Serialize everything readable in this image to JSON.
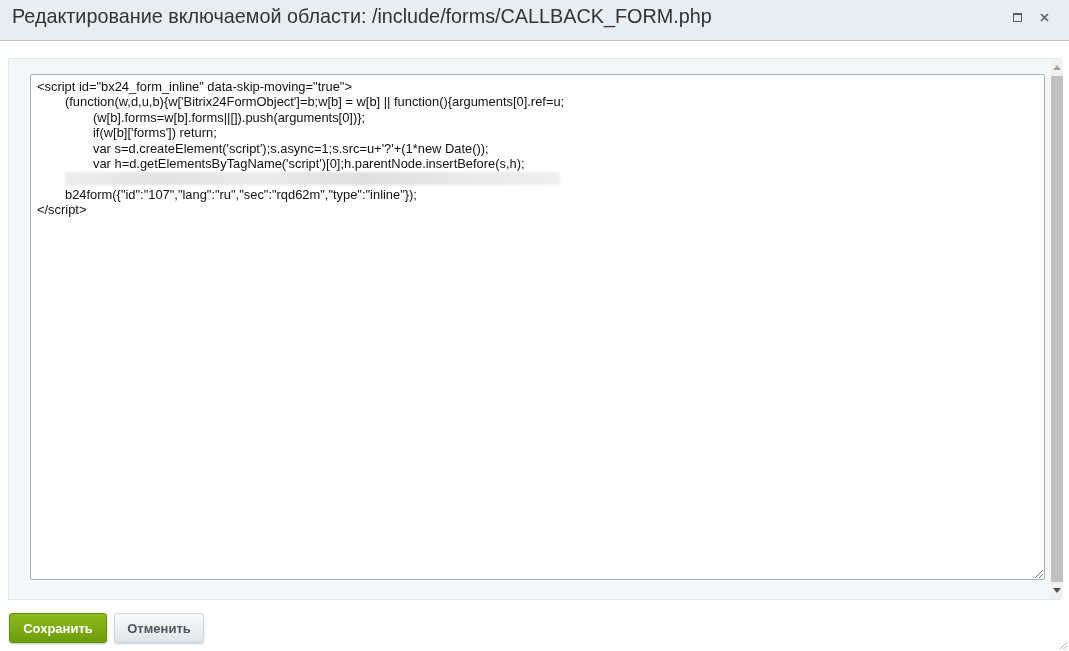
{
  "window": {
    "title": "Редактирование включаемой области: /include/forms/CALLBACK_FORM.php"
  },
  "editor": {
    "lines": [
      {
        "kind": "text",
        "text": "<script id=\"bx24_form_inline\" data-skip-moving=\"true\">",
        "children": [
          {
            "kind": "text",
            "text": "(function(w,d,u,b){w['Bitrix24FormObject']=b;w[b] = w[b] || function(){arguments[0].ref=u;",
            "children": [
              {
                "kind": "text",
                "text": "(w[b].forms=w[b].forms||[]).push(arguments[0])};"
              },
              {
                "kind": "text",
                "text": "if(w[b]['forms']) return;"
              },
              {
                "kind": "text",
                "text": "var s=d.createElement('script');s.async=1;s.src=u+'?'+(1*new Date());"
              },
              {
                "kind": "text",
                "text": "var h=d.getElementsByTagName('script')[0];h.parentNode.insertBefore(s,h);"
              }
            ]
          },
          {
            "kind": "redacted"
          },
          {
            "kind": "text",
            "text": "b24form({\"id\":\"107\",\"lang\":\"ru\",\"sec\":\"rqd62m\",\"type\":\"inline\"});"
          }
        ]
      },
      {
        "kind": "text",
        "text": "</script>"
      }
    ]
  },
  "buttons": [
    {
      "label": "Сохранить",
      "kind": "primary"
    },
    {
      "label": "Отменить",
      "kind": "secondary"
    }
  ]
}
